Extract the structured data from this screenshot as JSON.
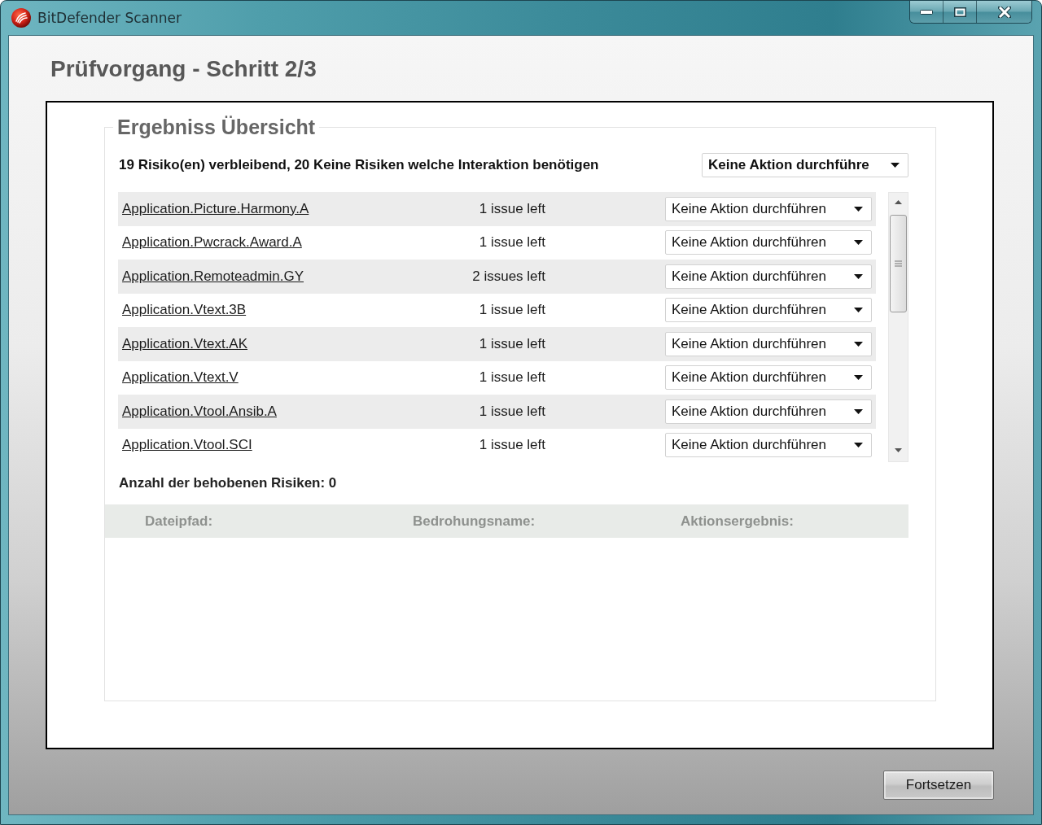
{
  "window": {
    "title": "BitDefender Scanner"
  },
  "heading": "Prüfvorgang - Schritt 2/3",
  "results": {
    "legend": "Ergebniss Übersicht",
    "summary": "19 Risiko(en) verbleibend, 20 Keine Risiken welche Interaktion benötigen",
    "bulk_action": "Keine Aktion durchführe",
    "threats": [
      {
        "name": "Application.Picture.Harmony.A",
        "issues": "1 issue left",
        "action": "Keine Aktion durchführen"
      },
      {
        "name": "Application.Pwcrack.Award.A",
        "issues": "1 issue left",
        "action": "Keine Aktion durchführen"
      },
      {
        "name": "Application.Remoteadmin.GY",
        "issues": "2 issues left",
        "action": "Keine Aktion durchführen"
      },
      {
        "name": "Application.Vtext.3B",
        "issues": "1 issue left",
        "action": "Keine Aktion durchführen"
      },
      {
        "name": "Application.Vtext.AK",
        "issues": "1 issue left",
        "action": "Keine Aktion durchführen"
      },
      {
        "name": "Application.Vtext.V",
        "issues": "1 issue left",
        "action": "Keine Aktion durchführen"
      },
      {
        "name": "Application.Vtool.Ansib.A",
        "issues": "1 issue left",
        "action": "Keine Aktion durchführen"
      },
      {
        "name": "Application.Vtool.SCI",
        "issues": "1 issue left",
        "action": "Keine Aktion durchführen"
      }
    ],
    "fixed_summary": "Anzahl der behobenen Risiken: 0",
    "fixed_table": {
      "columns": [
        "Dateipfad:",
        "Bedrohungsname:",
        "Aktionsergebnis:"
      ]
    }
  },
  "buttons": [
    {
      "label": "Fortsetzen"
    }
  ]
}
